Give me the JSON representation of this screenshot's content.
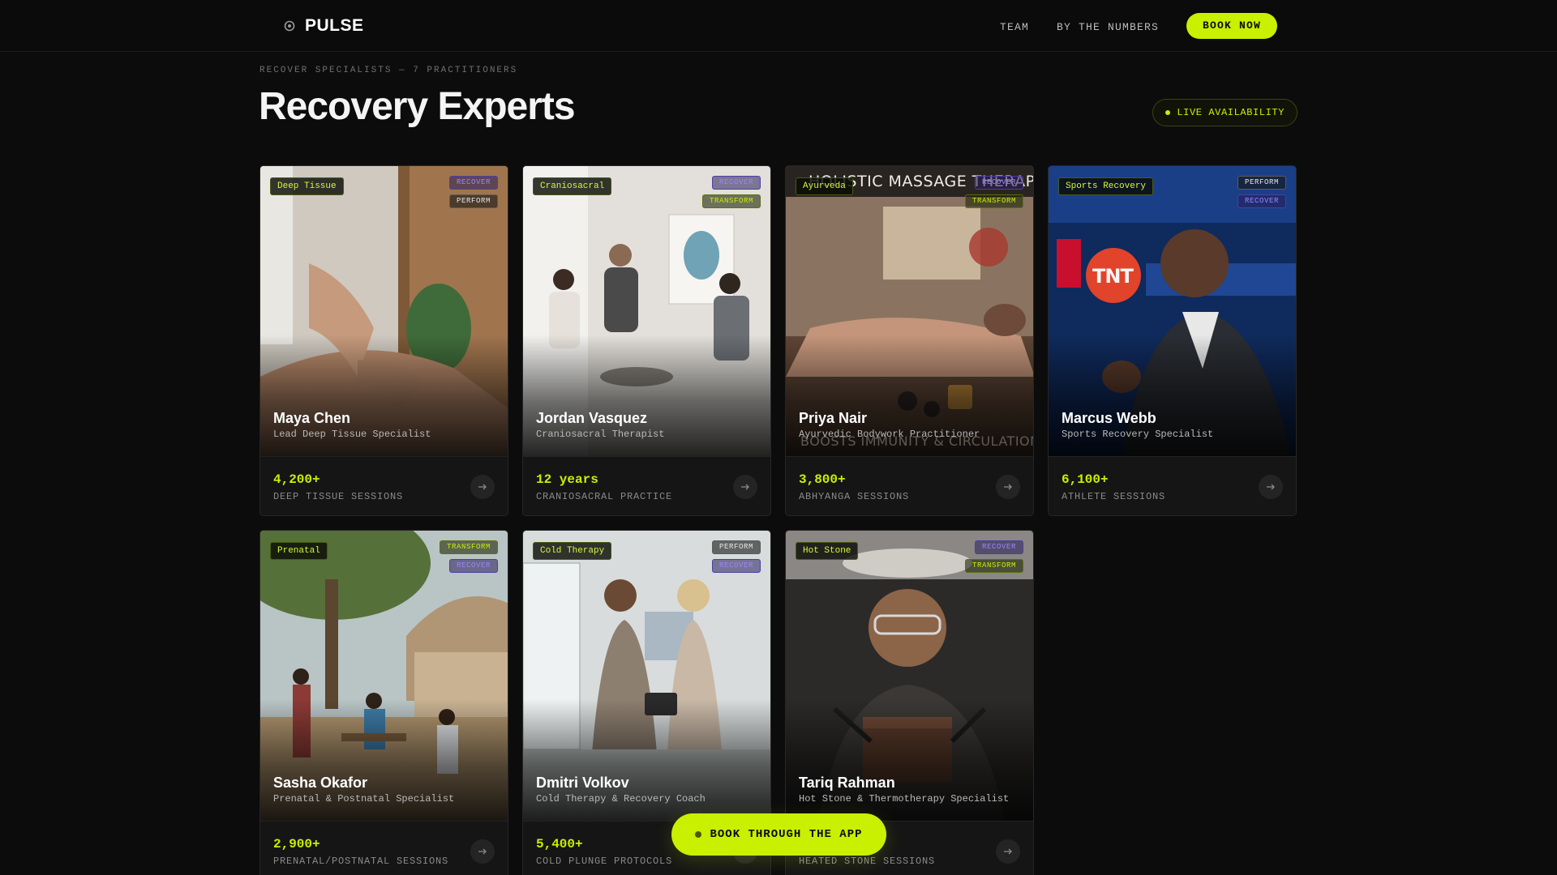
{
  "nav": {
    "brand": "PULSE",
    "links": [
      "TEAM",
      "BY THE NUMBERS"
    ],
    "cta": "BOOK NOW"
  },
  "header": {
    "eyebrow": "RECOVER SPECIALISTS — 7 PRACTITIONERS",
    "title": "Recovery Experts",
    "live_label": "LIVE AVAILABILITY"
  },
  "colors": {
    "accent": "#c8f000",
    "background": "#0c0c0c",
    "recover": "#9a85ff"
  },
  "experts": [
    {
      "specialty": "Deep Tissue",
      "badges": [
        "RECOVER",
        "PERFORM"
      ],
      "name": "Maya Chen",
      "role": "Lead Deep Tissue Specialist",
      "stat_value": "4,200+",
      "stat_label": "DEEP TISSUE SESSIONS"
    },
    {
      "specialty": "Craniosacral",
      "badges": [
        "RECOVER",
        "TRANSFORM"
      ],
      "name": "Jordan Vasquez",
      "role": "Craniosacral Therapist",
      "stat_value": "12 years",
      "stat_label": "CRANIOSACRAL PRACTICE"
    },
    {
      "specialty": "Ayurveda",
      "badges": [
        "RECOVER",
        "TRANSFORM"
      ],
      "name": "Priya Nair",
      "role": "Ayurvedic Bodywork Practitioner",
      "stat_value": "3,800+",
      "stat_label": "ABHYANGA SESSIONS",
      "image_text_top": "HOLISTIC MASSAGE THERAPY",
      "image_text_bottom": "BOOSTS IMMUNITY & CIRCULATION"
    },
    {
      "specialty": "Sports Recovery",
      "badges": [
        "PERFORM",
        "RECOVER"
      ],
      "name": "Marcus Webb",
      "role": "Sports Recovery Specialist",
      "stat_value": "6,100+",
      "stat_label": "ATHLETE SESSIONS",
      "image_text_top": "TNT"
    },
    {
      "specialty": "Prenatal",
      "badges": [
        "TRANSFORM",
        "RECOVER"
      ],
      "name": "Sasha Okafor",
      "role": "Prenatal & Postnatal Specialist",
      "stat_value": "2,900+",
      "stat_label": "PRENATAL/POSTNATAL SESSIONS"
    },
    {
      "specialty": "Cold Therapy",
      "badges": [
        "PERFORM",
        "RECOVER"
      ],
      "name": "Dmitri Volkov",
      "role": "Cold Therapy & Recovery Coach",
      "stat_value": "5,400+",
      "stat_label": "COLD PLUNGE PROTOCOLS"
    },
    {
      "specialty": "Hot Stone",
      "badges": [
        "RECOVER",
        "TRANSFORM"
      ],
      "name": "Tariq Rahman",
      "role": "Hot Stone & Thermotherapy Specialist",
      "stat_value": "",
      "stat_label": "HEATED STONE SESSIONS"
    }
  ],
  "fab": {
    "label": "BOOK THROUGH THE APP"
  }
}
